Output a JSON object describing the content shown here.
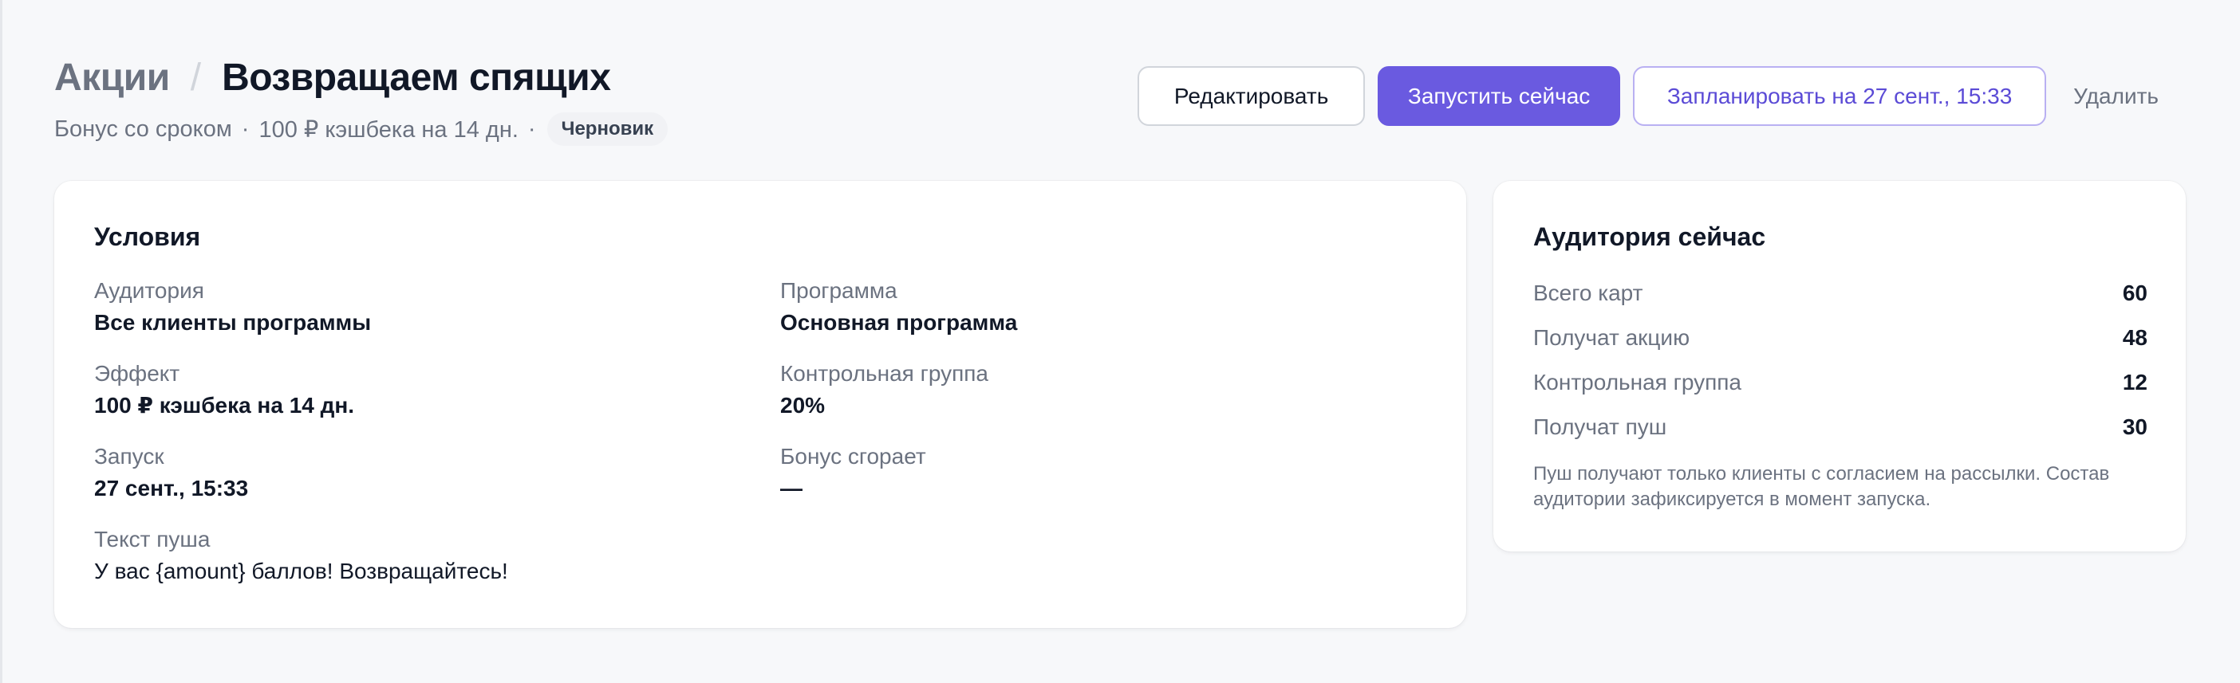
{
  "header": {
    "breadcrumb_parent": "Акции",
    "breadcrumb_separator": "/",
    "title": "Возвращаем спящих",
    "subtitle_type": "Бонус со сроком",
    "subtitle_effect": "100 ₽ кэшбека на 14 дн.",
    "subtitle_dot": "·",
    "status_badge": "Черновик"
  },
  "actions": {
    "edit_label": "Редактировать",
    "run_label": "Запустить сейчас",
    "schedule_label": "Запланировать на 27 сент., 15:33",
    "delete_label": "Удалить"
  },
  "conditions": {
    "title": "Условия",
    "fields": [
      {
        "label": "Аудитория",
        "value": "Все клиенты программы"
      },
      {
        "label": "Программа",
        "value": "Основная программа"
      },
      {
        "label": "Эффект",
        "value": "100 ₽ кэшбека на 14 дн."
      },
      {
        "label": "Контрольная группа",
        "value": "20%"
      },
      {
        "label": "Запуск",
        "value": "27 сент., 15:33"
      },
      {
        "label": "Бонус сгорает",
        "value": "—"
      },
      {
        "label": "Текст пуша",
        "value": "У вас {amount} баллов! Возвращайтесь!"
      }
    ]
  },
  "audience": {
    "title": "Аудитория сейчас",
    "stats": [
      {
        "label": "Всего карт",
        "value": "60"
      },
      {
        "label": "Получат акцию",
        "value": "48"
      },
      {
        "label": "Контрольная группа",
        "value": "12"
      },
      {
        "label": "Получат пуш",
        "value": "30"
      }
    ],
    "note": "Пуш получают только клиенты с согласием на рассылки. Состав аудитории зафиксируется в момент запуска."
  },
  "colors": {
    "accent": "#6a5ae0",
    "background": "#f7f8fa",
    "card": "#ffffff",
    "muted_text": "#6b7280"
  }
}
